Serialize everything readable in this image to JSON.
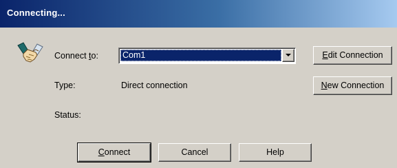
{
  "window": {
    "title": "Connecting..."
  },
  "connect_to": {
    "label_prefix": "Connect ",
    "label_mnemonic": "t",
    "label_suffix": "o:",
    "selected_value": "Com1"
  },
  "type": {
    "label": "Type:",
    "value": "Direct connection"
  },
  "status": {
    "label": "Status:",
    "value": ""
  },
  "buttons": {
    "edit_connection": {
      "mnemonic": "E",
      "rest": "dit Connection"
    },
    "new_connection": {
      "mnemonic": "N",
      "rest": "ew Connection"
    },
    "connect": {
      "mnemonic": "C",
      "rest": "onnect"
    },
    "cancel": {
      "label": "Cancel"
    },
    "help": {
      "label": "Help"
    }
  },
  "icons": {
    "app_icon": "handshake-icon",
    "dropdown_arrow": "chevron-down-icon"
  },
  "colors": {
    "titlebar_start": "#0a246a",
    "titlebar_end": "#a6caf0",
    "face": "#d4d0c8",
    "selection": "#0a246a"
  }
}
